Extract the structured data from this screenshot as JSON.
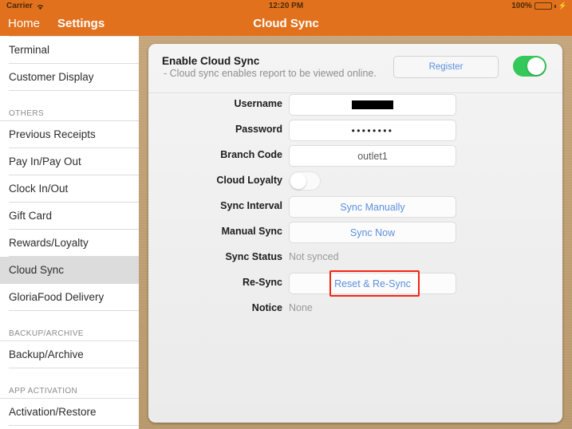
{
  "status_bar": {
    "carrier": "Carrier",
    "wifi_icon": "wifi-icon",
    "time": "12:20 PM",
    "battery_percent": "100%",
    "battery_icon": "battery-charging-icon"
  },
  "nav_bar": {
    "home_label": "Home",
    "settings_label": "Settings",
    "title": "Cloud Sync",
    "background_color": "#e2711d"
  },
  "sidebar": {
    "items": [
      {
        "label": "Terminal",
        "selected": false
      },
      {
        "label": "Customer Display",
        "selected": false
      }
    ],
    "groups": [
      {
        "header": "OTHERS",
        "items": [
          {
            "label": "Previous Receipts",
            "selected": false
          },
          {
            "label": "Pay In/Pay Out",
            "selected": false
          },
          {
            "label": "Clock In/Out",
            "selected": false
          },
          {
            "label": "Gift Card",
            "selected": false
          },
          {
            "label": "Rewards/Loyalty",
            "selected": false
          },
          {
            "label": "Cloud Sync",
            "selected": true
          },
          {
            "label": "GloriaFood Delivery",
            "selected": false
          }
        ]
      },
      {
        "header": "BACKUP/ARCHIVE",
        "items": [
          {
            "label": "Backup/Archive",
            "selected": false
          }
        ]
      },
      {
        "header": "APP ACTIVATION",
        "items": [
          {
            "label": "Activation/Restore",
            "selected": false
          }
        ]
      }
    ]
  },
  "main": {
    "header": {
      "title": "Enable Cloud Sync",
      "subtitle": "- Cloud sync enables report to be viewed online.",
      "register_label": "Register",
      "toggle_state": "on",
      "toggle_color": "#34c759"
    },
    "rows": [
      {
        "label": "Username",
        "value": "",
        "type": "redacted"
      },
      {
        "label": "Password",
        "value": "••••••••",
        "type": "password"
      },
      {
        "label": "Branch Code",
        "value": "outlet1",
        "type": "text"
      },
      {
        "label": "Cloud Loyalty",
        "value": "off",
        "type": "toggle"
      },
      {
        "label": "Sync Interval",
        "value": "Sync Manually",
        "type": "link-button"
      },
      {
        "label": "Manual Sync",
        "value": "Sync Now",
        "type": "link-button"
      },
      {
        "label": "Sync Status",
        "value": "Not synced",
        "type": "plain"
      },
      {
        "label": "Re-Sync",
        "value": "Reset & Re-Sync",
        "type": "link-button-annotated"
      },
      {
        "label": "Notice",
        "value": "None",
        "type": "plain"
      }
    ],
    "annotation_color": "#f22613",
    "link_color": "#5a8fe0",
    "panel_background": "#c2a174"
  }
}
